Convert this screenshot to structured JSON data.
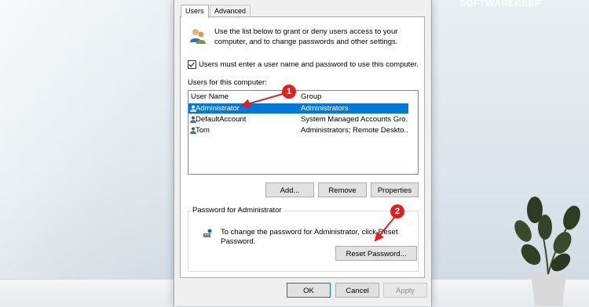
{
  "watermark": "SOFTWAREKEEP",
  "dialog": {
    "tabs": [
      {
        "label": "Users",
        "active": true
      },
      {
        "label": "Advanced",
        "active": false
      }
    ],
    "intro_text": "Use the list below to grant or deny users access to your computer, and to change passwords and other settings.",
    "require_login_checkbox": {
      "label": "Users must enter a user name and password to use this computer.",
      "checked": true
    },
    "users_list_label": "Users for this computer:",
    "columns": {
      "user_name": "User Name",
      "group": "Group"
    },
    "users": [
      {
        "name": "Administrator",
        "group": "Administrators",
        "selected": true
      },
      {
        "name": "DefaultAccount",
        "group": "System Managed Accounts Gro...",
        "selected": false
      },
      {
        "name": "Tom",
        "group": "Administrators; Remote Deskto...",
        "selected": false
      }
    ],
    "buttons": {
      "add": "Add...",
      "remove": "Remove",
      "properties": "Properties"
    },
    "password_group": {
      "title": "Password for Administrator",
      "text": "To change the password for Administrator, click Reset Password.",
      "reset_button": "Reset Password..."
    },
    "footer": {
      "ok": "OK",
      "cancel": "Cancel",
      "apply": "Apply"
    }
  },
  "annotations": {
    "marker_1": "1",
    "marker_2": "2"
  },
  "colors": {
    "selection": "#0078d7",
    "annotation": "#e02020"
  }
}
